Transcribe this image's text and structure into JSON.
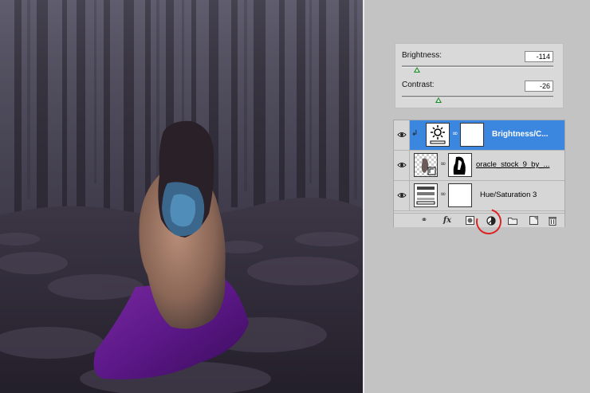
{
  "adjustments": {
    "brightness": {
      "label": "Brightness:",
      "value": "-114",
      "slider_fraction": 0.1
    },
    "contrast": {
      "label": "Contrast:",
      "value": "-26",
      "slider_fraction": 0.24
    }
  },
  "layers": [
    {
      "name": "Brightness/C...",
      "selected": true,
      "clipped": true,
      "thumb_icon": "sun-adjustment-icon"
    },
    {
      "name": "oracle_stock_9_by_...",
      "selected": false,
      "clipped": false,
      "thumb_icon": "smart-object-icon"
    },
    {
      "name": "Hue/Saturation 3",
      "selected": false,
      "clipped": false,
      "thumb_icon": "hue-saturation-icon"
    }
  ],
  "footer_icons": [
    "link-icon",
    "fx-icon",
    "layer-mask-icon",
    "adjustment-layer-icon",
    "group-folder-icon",
    "new-layer-icon",
    "trash-icon"
  ],
  "fx_label": "fx",
  "colors": {
    "selected_layer": "#3b87e0",
    "highlight_circle": "#dd2222",
    "slider_thumb": "#1b8a2a"
  }
}
